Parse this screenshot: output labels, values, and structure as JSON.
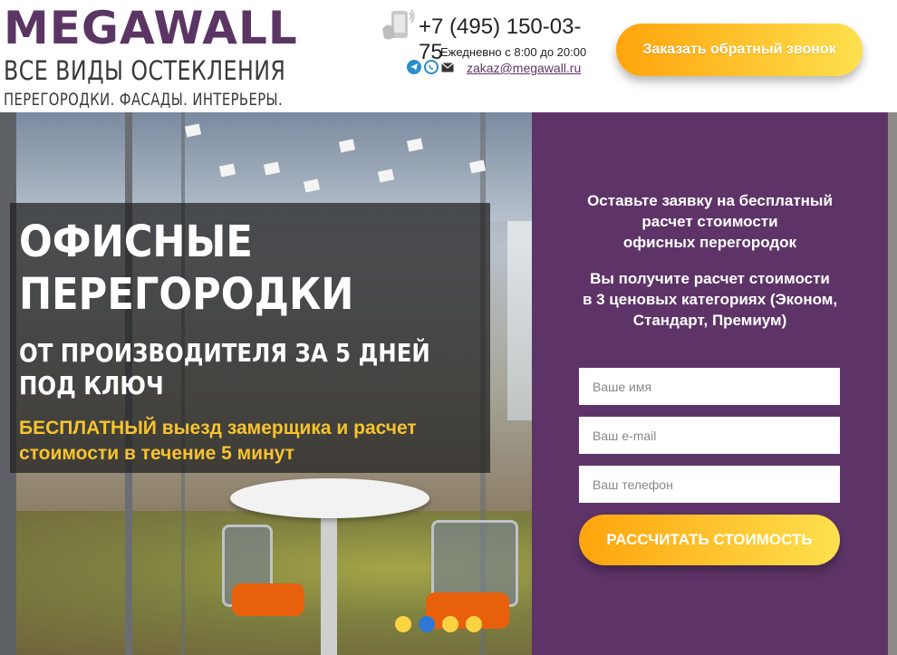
{
  "header": {
    "logo": "MEGAWALL",
    "tagline": "ВСЕ ВИДЫ ОСТЕКЛЕНИЯ",
    "subtagline": "ПЕРЕГОРОДКИ. ФАСАДЫ. ИНТЕРЬЕРЫ.",
    "phone": "+7 (495) 150-03-75",
    "hours": "Ежедневно с 8:00 до 20:00",
    "email": "zakaz@megawall.ru",
    "callback_label": "Заказать обратный звонок",
    "messenger_icons": [
      "telegram-icon",
      "whatsapp-icon",
      "mail-icon"
    ]
  },
  "hero": {
    "title_line1": "ОФИСНЫЕ",
    "title_line2": "ПЕРЕГОРОДКИ",
    "subtitle_line1": "ОТ ПРОИЗВОДИТЕЛЯ ЗА 5 ДНЕЙ",
    "subtitle_line2": "ПОД КЛЮЧ",
    "offer_highlight": "БЕСПЛАТНЫЙ",
    "offer_rest": " выезд замерщика и расчет",
    "offer_line2": "стоимости в течение 5 минут",
    "slides": 4,
    "active_slide": 2
  },
  "form": {
    "intro_line1": "Оставьте заявку на бесплатный",
    "intro_line2": "расчет стоимости",
    "intro_line3": "офисных перегородок",
    "benefit_line1": "Вы получите расчет стоимости",
    "benefit_line2": "в 3 ценовых категориях (Эконом,",
    "benefit_line3": "Стандарт, Премиум)",
    "name_placeholder": "Ваше имя",
    "email_placeholder": "Ваш e-mail",
    "phone_placeholder": "Ваш телефон",
    "submit_label": "РАССЧИТАТЬ СТОИМОСТЬ"
  },
  "colors": {
    "brand_purple": "#5e3468",
    "accent_orange": "#ffa40c",
    "accent_yellow": "#fde04e",
    "offer_yellow": "#f7c32e",
    "active_dot": "#2c78d6"
  }
}
